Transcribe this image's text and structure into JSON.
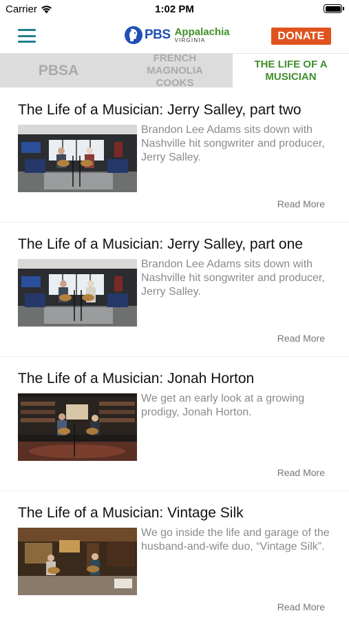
{
  "status_bar": {
    "carrier": "Carrier",
    "time": "1:02 PM",
    "battery_level_percent": 100
  },
  "header": {
    "menu_icon": "hamburger-menu-icon",
    "logo_icon": "pbs-head-icon",
    "logo_pbs": "PBS",
    "logo_station": "Appalachia",
    "logo_state": "VIRGINIA",
    "donate_label": "DONATE",
    "colors": {
      "accent_teal": "#1d7f8a",
      "pbs_blue": "#1f4fb5",
      "station_green": "#3f8f2a",
      "donate_orange": "#e0531e"
    }
  },
  "tabs": [
    {
      "label": "PBSA",
      "active": false
    },
    {
      "label": "FRENCH MAGNOLIA COOKS",
      "active": false
    },
    {
      "label": "THE LIFE OF A MUSICIAN",
      "active": true
    }
  ],
  "articles": [
    {
      "title": "The Life of a Musician: Jerry Salley, part two",
      "description": "Brandon Lee Adams sits down with Nashville hit songwriter and producer, Jerry Salley.",
      "read_more": "Read More",
      "thumbnail": "studio-two-guitarists"
    },
    {
      "title": "The Life of a Musician: Jerry Salley, part one",
      "description": "Brandon Lee Adams sits down with Nashville hit songwriter and producer, Jerry Salley.",
      "read_more": "Read More",
      "thumbnail": "studio-two-guitarists"
    },
    {
      "title": "The Life of a Musician: Jonah Horton",
      "description": "We get an early look at a growing prodigy, Jonah Horton.",
      "read_more": "Read More",
      "thumbnail": "library-two-guitarists"
    },
    {
      "title": "The Life of a Musician: Vintage Silk",
      "description": "We go inside the life and garage of the husband-and-wife duo, “Vintage Silk”.",
      "read_more": "Read More",
      "thumbnail": "garage-duo"
    }
  ]
}
